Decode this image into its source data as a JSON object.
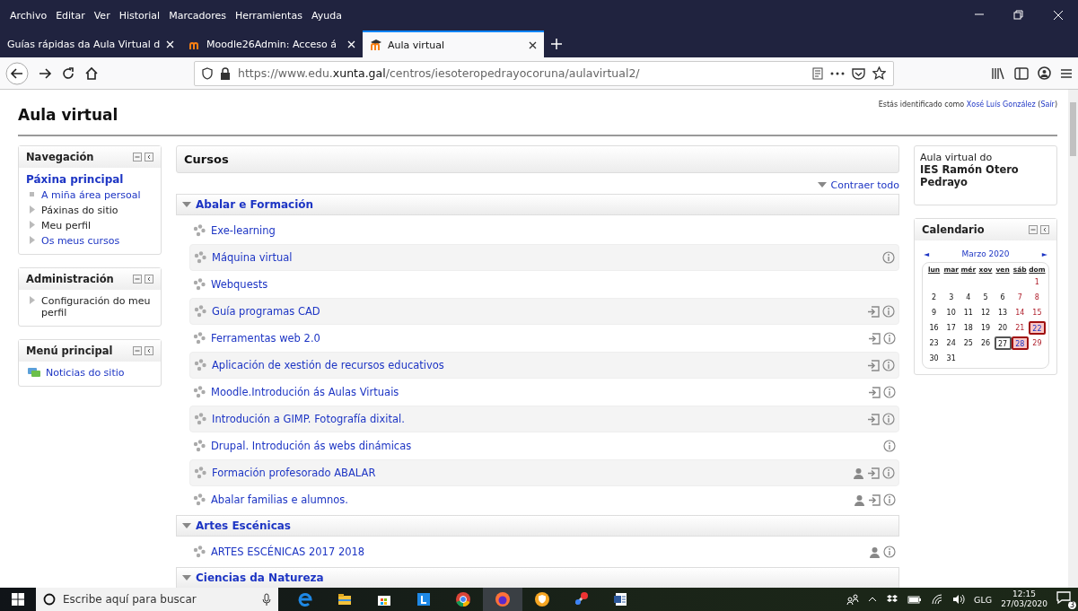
{
  "menu_bar": [
    "Archivo",
    "Editar",
    "Ver",
    "Historial",
    "Marcadores",
    "Herramientas",
    "Ayuda"
  ],
  "tabs": [
    {
      "label": "Guías rápidas da Aula Virtual d",
      "selected": false,
      "kind": "plain"
    },
    {
      "label": "Moodle26Admin: Acceso á",
      "selected": false,
      "kind": "moodle"
    },
    {
      "label": "Aula virtual",
      "selected": true,
      "kind": "moodlecap"
    }
  ],
  "address": {
    "prefix": "https://www.edu.",
    "domain": "xunta.gal",
    "path": "/centros/iesoteropedrayocoruna/aulavirtual2/"
  },
  "page": {
    "site_title": "Aula virtual",
    "login": {
      "text": "Estás identificado como",
      "user": "Xosé Luís González",
      "open": "(",
      "logout": "Saír",
      "close": ")"
    },
    "left_blocks": [
      {
        "title": "Navegación",
        "items": [
          {
            "label": "Páxina principal",
            "kind": "heading"
          },
          {
            "label": "A miña área persoal",
            "kind": "bullet"
          },
          {
            "label": "Páxinas do sitio",
            "kind": "branch"
          },
          {
            "label": "Meu perfil",
            "kind": "branch"
          },
          {
            "label": "Os meus cursos",
            "kind": "branchlink"
          }
        ]
      },
      {
        "title": "Administración",
        "items": [
          {
            "label": "Configuración do meu perfil",
            "kind": "branch"
          }
        ]
      },
      {
        "title": "Menú principal",
        "items": [
          {
            "label": "Noticias do sitio",
            "kind": "forum"
          }
        ]
      }
    ],
    "courses": {
      "title": "Cursos",
      "collapse_all": "Contraer todo",
      "categories": [
        {
          "name": "Abalar e Formación",
          "expanded": true,
          "courses": [
            {
              "name": "Exe-learning"
            },
            {
              "name": "Máquina virtual",
              "actions": [
                {
                  "kind": "info"
                }
              ]
            },
            {
              "name": "Webquests"
            },
            {
              "name": "Guía programas CAD",
              "actions": [
                {
                  "kind": "enrol"
                },
                {
                  "kind": "info"
                }
              ]
            },
            {
              "name": "Ferramentas web 2.0",
              "actions": [
                {
                  "kind": "enrol"
                },
                {
                  "kind": "info"
                }
              ]
            },
            {
              "name": "Aplicación de xestión de recursos educativos",
              "actions": [
                {
                  "kind": "enrol"
                },
                {
                  "kind": "info"
                }
              ]
            },
            {
              "name": "Moodle.Introdución ás Aulas Virtuais",
              "actions": [
                {
                  "kind": "enrol"
                },
                {
                  "kind": "info"
                }
              ]
            },
            {
              "name": "Introdución a GIMP. Fotografía dixital.",
              "actions": [
                {
                  "kind": "enrol"
                },
                {
                  "kind": "info"
                }
              ]
            },
            {
              "name": "Drupal. Introdución ás webs dinámicas",
              "actions": [
                {
                  "kind": "info"
                }
              ]
            },
            {
              "name": "Formación profesorado ABALAR",
              "actions": [
                {
                  "kind": "guest"
                },
                {
                  "kind": "enrol"
                },
                {
                  "kind": "info"
                }
              ]
            },
            {
              "name": "Abalar familias e alumnos.",
              "actions": [
                {
                  "kind": "guest"
                },
                {
                  "kind": "enrol"
                },
                {
                  "kind": "info"
                }
              ]
            }
          ]
        },
        {
          "name": "Artes Escénicas",
          "expanded": true,
          "courses": [
            {
              "name": "ARTES ESCÉNICAS 2017 2018",
              "actions": [
                {
                  "kind": "guest"
                },
                {
                  "kind": "info"
                }
              ]
            }
          ]
        },
        {
          "name": "Ciencias da Natureza",
          "expanded": true
        }
      ]
    },
    "site_block": {
      "line1": "Aula virtual do",
      "line2": "IES Ramón Otero Pedrayo"
    },
    "calendar": {
      "title": "Calendario",
      "prev": "◄",
      "month": "Marzo 2020",
      "next": "►",
      "weekdays": [
        "lun",
        "mar",
        "mér",
        "xov",
        "ven",
        "sáb",
        "dom"
      ],
      "weeks": [
        {
          "kind": "first",
          "days": [
            {
              "day": "1",
              "weekend": true,
              "event": false,
              "today": false
            }
          ]
        },
        {
          "days": [
            {
              "day": "2",
              "weekend": false,
              "event": false,
              "today": false
            },
            {
              "day": "3",
              "weekend": false,
              "event": false,
              "today": false
            },
            {
              "day": "4",
              "weekend": false,
              "event": false,
              "today": false
            },
            {
              "day": "5",
              "weekend": false,
              "event": false,
              "today": false
            },
            {
              "day": "6",
              "weekend": false,
              "event": false,
              "today": false
            },
            {
              "day": "7",
              "weekend": true,
              "event": false,
              "today": false
            },
            {
              "day": "8",
              "weekend": true,
              "event": false,
              "today": false
            }
          ]
        },
        {
          "days": [
            {
              "day": "9",
              "weekend": false,
              "event": false,
              "today": false
            },
            {
              "day": "10",
              "weekend": false,
              "event": false,
              "today": false
            },
            {
              "day": "11",
              "weekend": false,
              "event": false,
              "today": false
            },
            {
              "day": "12",
              "weekend": false,
              "event": false,
              "today": false
            },
            {
              "day": "13",
              "weekend": false,
              "event": false,
              "today": false
            },
            {
              "day": "14",
              "weekend": true,
              "event": false,
              "today": false
            },
            {
              "day": "15",
              "weekend": true,
              "event": false,
              "today": false
            }
          ]
        },
        {
          "days": [
            {
              "day": "16",
              "weekend": false,
              "event": false,
              "today": false
            },
            {
              "day": "17",
              "weekend": false,
              "event": false,
              "today": false
            },
            {
              "day": "18",
              "weekend": false,
              "event": false,
              "today": false
            },
            {
              "day": "19",
              "weekend": false,
              "event": false,
              "today": false
            },
            {
              "day": "20",
              "weekend": false,
              "event": false,
              "today": false
            },
            {
              "day": "21",
              "weekend": true,
              "event": false,
              "today": false
            },
            {
              "day": "22",
              "weekend": true,
              "event": true,
              "today": false
            }
          ]
        },
        {
          "days": [
            {
              "day": "23",
              "weekend": false,
              "event": false,
              "today": false
            },
            {
              "day": "24",
              "weekend": false,
              "event": false,
              "today": false
            },
            {
              "day": "25",
              "weekend": false,
              "event": false,
              "today": false
            },
            {
              "day": "26",
              "weekend": false,
              "event": false,
              "today": false
            },
            {
              "day": "27",
              "weekend": false,
              "event": false,
              "today": true
            },
            {
              "day": "28",
              "weekend": true,
              "event": true,
              "today": false
            },
            {
              "day": "29",
              "weekend": true,
              "event": false,
              "today": false
            }
          ]
        },
        {
          "kind": "last",
          "days": [
            {
              "day": "30",
              "weekend": false,
              "event": false,
              "today": false
            },
            {
              "day": "31",
              "weekend": false,
              "event": false,
              "today": false
            }
          ]
        }
      ]
    }
  },
  "taskbar": {
    "search_placeholder": "Escribe aquí para buscar",
    "language": "GLG",
    "time": "12:15",
    "date": "27/03/2020",
    "notifications": "3"
  }
}
